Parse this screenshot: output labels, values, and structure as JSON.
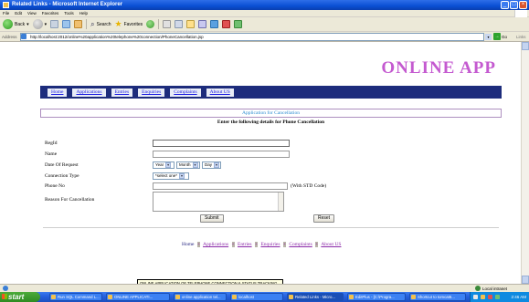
{
  "window": {
    "title": "Related Links - Microsoft Internet Explorer",
    "controls": [
      "_",
      "□",
      "×"
    ]
  },
  "menubar": {
    "items": [
      "File",
      "Edit",
      "View",
      "Favorites",
      "Tools",
      "Help"
    ]
  },
  "toolbar": {
    "back_label": "Back",
    "search_label": "Search",
    "favorites_label": "Favorites"
  },
  "address": {
    "label": "Address",
    "url": "http://localhost:2012/online%20application%20telephone%20connection/PhoneCancellation.jsp",
    "go_label": "Go",
    "links_label": "Links"
  },
  "page": {
    "app_title": "ONLINE APP",
    "nav": [
      "Home",
      "Applications",
      "Entries",
      "Enquiries",
      "Complaints",
      "About US"
    ],
    "form_heading": "Application for Cancellation",
    "form_subheading": "Enter the following details for Phone Cancellation",
    "fields": {
      "regid_label": "RegId",
      "name_label": "Name",
      "date_label": "Date Of Request",
      "year_value": "Year",
      "month_value": "Month",
      "day_value": "Day",
      "conn_label": "Connection Type",
      "conn_value": "*select one*",
      "phone_label": "Phone No",
      "std_hint": "(With STD Code)",
      "reason_label": "Reason For Cancellation"
    },
    "submit_label": "Submit",
    "reset_label": "Reset",
    "footer": {
      "home": "Home",
      "items": [
        "Applications",
        "Entries",
        "Enquiries",
        "Complaints",
        "About US"
      ],
      "separator": "+"
    }
  },
  "tooltip": {
    "text": "ONLINE APPLICATION OF TELEPHONE CONNECTION & STATUS TRACKING SYSTEM Screens [Co"
  },
  "statusbar": {
    "zone": "Local intranet"
  },
  "taskbar": {
    "start_label": "start",
    "tasks": [
      "Run SQL Command L...",
      "ONLINE APPLICATI...",
      "online application tel...",
      "localhost",
      "Related Links - Micro...",
      "EditPlus - [C:\\Progra...",
      "Shortcut to tomcat6..."
    ],
    "clock": "2:46 AM"
  },
  "colors": {
    "title_accent": "#c45ad0",
    "nav_band": "#1d2c7c",
    "heading_blue": "#2b8cd0",
    "footer_link": "#8b2aa8"
  }
}
